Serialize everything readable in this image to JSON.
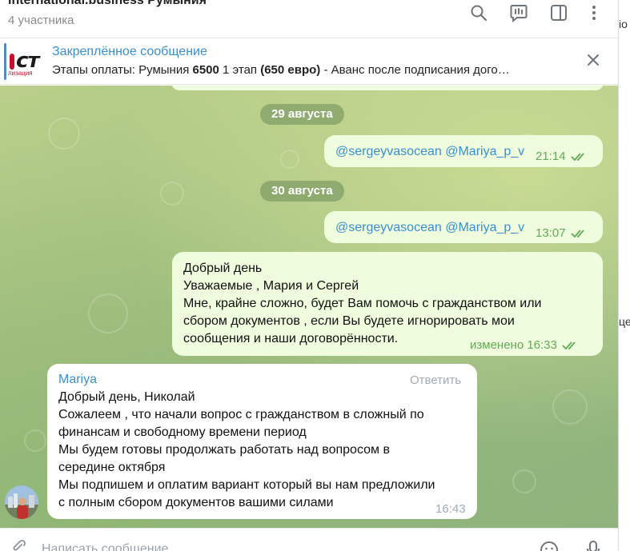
{
  "header": {
    "title": "international.business   Румыния",
    "subtitle": "4 участника",
    "icons": [
      "search-icon",
      "comments-icon",
      "sidebar-toggle-icon",
      "more-vert-icon"
    ]
  },
  "pinned": {
    "label": "Закреплённое сообщение",
    "text_prefix": "Этапы оплаты:  Румыния ",
    "text_bold1": "6500",
    "text_mid": " 1 этап ",
    "text_bold2": "(650 евро)",
    "text_suffix": " - Аванс после подписания дого…",
    "thumb_logo": "ст",
    "thumb_sub": "лизация"
  },
  "dates": [
    "29 августа",
    "30 августа"
  ],
  "messages": [
    {
      "mention1": "@sergeyvasocean",
      "mention2": "@Mariya_p_v",
      "time": "21:14"
    },
    {
      "mention1": "@sergeyvasocean",
      "mention2": "@Mariya_p_v",
      "time": "13:07"
    },
    {
      "lines": [
        "Добрый день",
        "Уважаемые , Мария и Сергей",
        "Мне, крайне сложно, будет Вам помочь с гражданством или",
        "сбором документов , если Вы будете игнорировать мои",
        "сообщения и наши договорённости."
      ],
      "time": "изменено 16:33"
    },
    {
      "sender": "Mariya",
      "reply": "Ответить",
      "lines": [
        "Добрый день, Николай",
        "Сожалеем , что начали вопрос с гражданством в сложный по",
        "финансам и свободному времени период",
        "Мы будем готовы продолжать работать над вопросом в",
        "середине октября",
        "Мы подпишем и оплатим вариант который вы нам предложили",
        "с полным сбором документов вашими силами"
      ],
      "time": "16:43"
    }
  ],
  "composer": {
    "placeholder": "Написать сообщение..."
  },
  "right_strip": {
    "texts": [
      "io",
      "це"
    ]
  },
  "colors": {
    "accent": "#3a8fd0",
    "outgoing_bubble": "#effdde",
    "check_green": "#63aa55",
    "bg_green": "#a6c283"
  }
}
